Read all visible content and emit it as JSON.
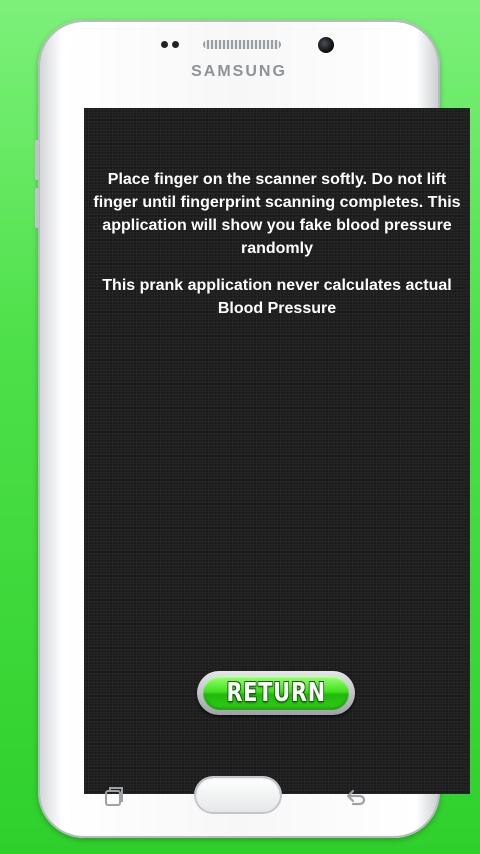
{
  "device": {
    "brand": "SAMSUNG"
  },
  "screen": {
    "message_primary": "Place finger on the scanner softly. Do not lift finger until fingerprint scanning completes. This application will show you fake blood pressure randomly",
    "message_disclaimer": "This prank application never calculates actual Blood Pressure",
    "return_label": "RETURN"
  },
  "nav": {
    "recent_icon": "recent-apps-icon",
    "home_icon": "home-button",
    "back_icon": "back-icon"
  },
  "colors": {
    "background": "#3fd83b",
    "screen": "#1e1e1f",
    "button_green": "#43e21f"
  }
}
